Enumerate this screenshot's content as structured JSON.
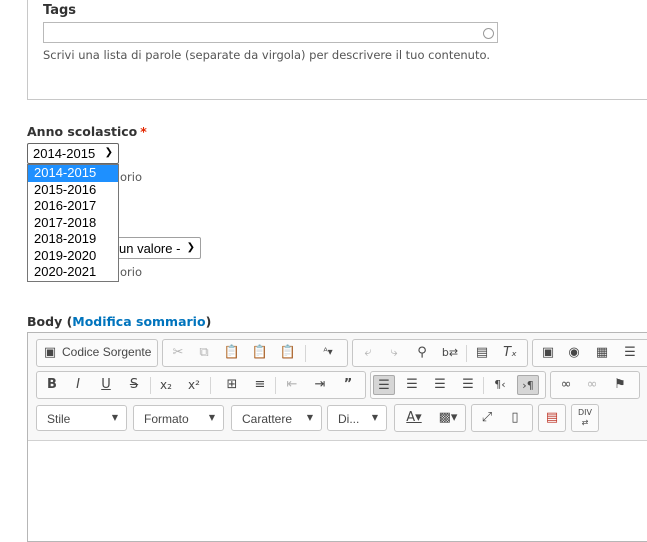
{
  "tags": {
    "label": "Tags",
    "value": "",
    "description": "Scrivi una lista di parole (separate da virgola) per descrivere il tuo contenuto."
  },
  "anno_scolastico": {
    "label": "Anno scolastico",
    "required_mark": "*",
    "selected": "2014-2015",
    "options": [
      "2014-2015",
      "2015-2016",
      "2016-2017",
      "2017-2018",
      "2018-2019",
      "2019-2020",
      "2020-2021"
    ],
    "hint_fragment": "orio"
  },
  "second_field": {
    "select_fragment": "un valore -",
    "hint_fragment": "orio"
  },
  "body": {
    "label_prefix": "Body (",
    "link_text": "Modifica sommario",
    "label_suffix": ")"
  },
  "toolbar": {
    "source_button": "Codice Sorgente",
    "combo_style": "Stile",
    "combo_format": "Formato",
    "combo_font": "Carattere",
    "combo_size": "Di...",
    "bold": "B",
    "italic": "I",
    "underline": "U",
    "strike": "S"
  },
  "colors": {
    "accent_link": "#0074bd",
    "required": "#e32700",
    "selection": "#1e90ff"
  }
}
